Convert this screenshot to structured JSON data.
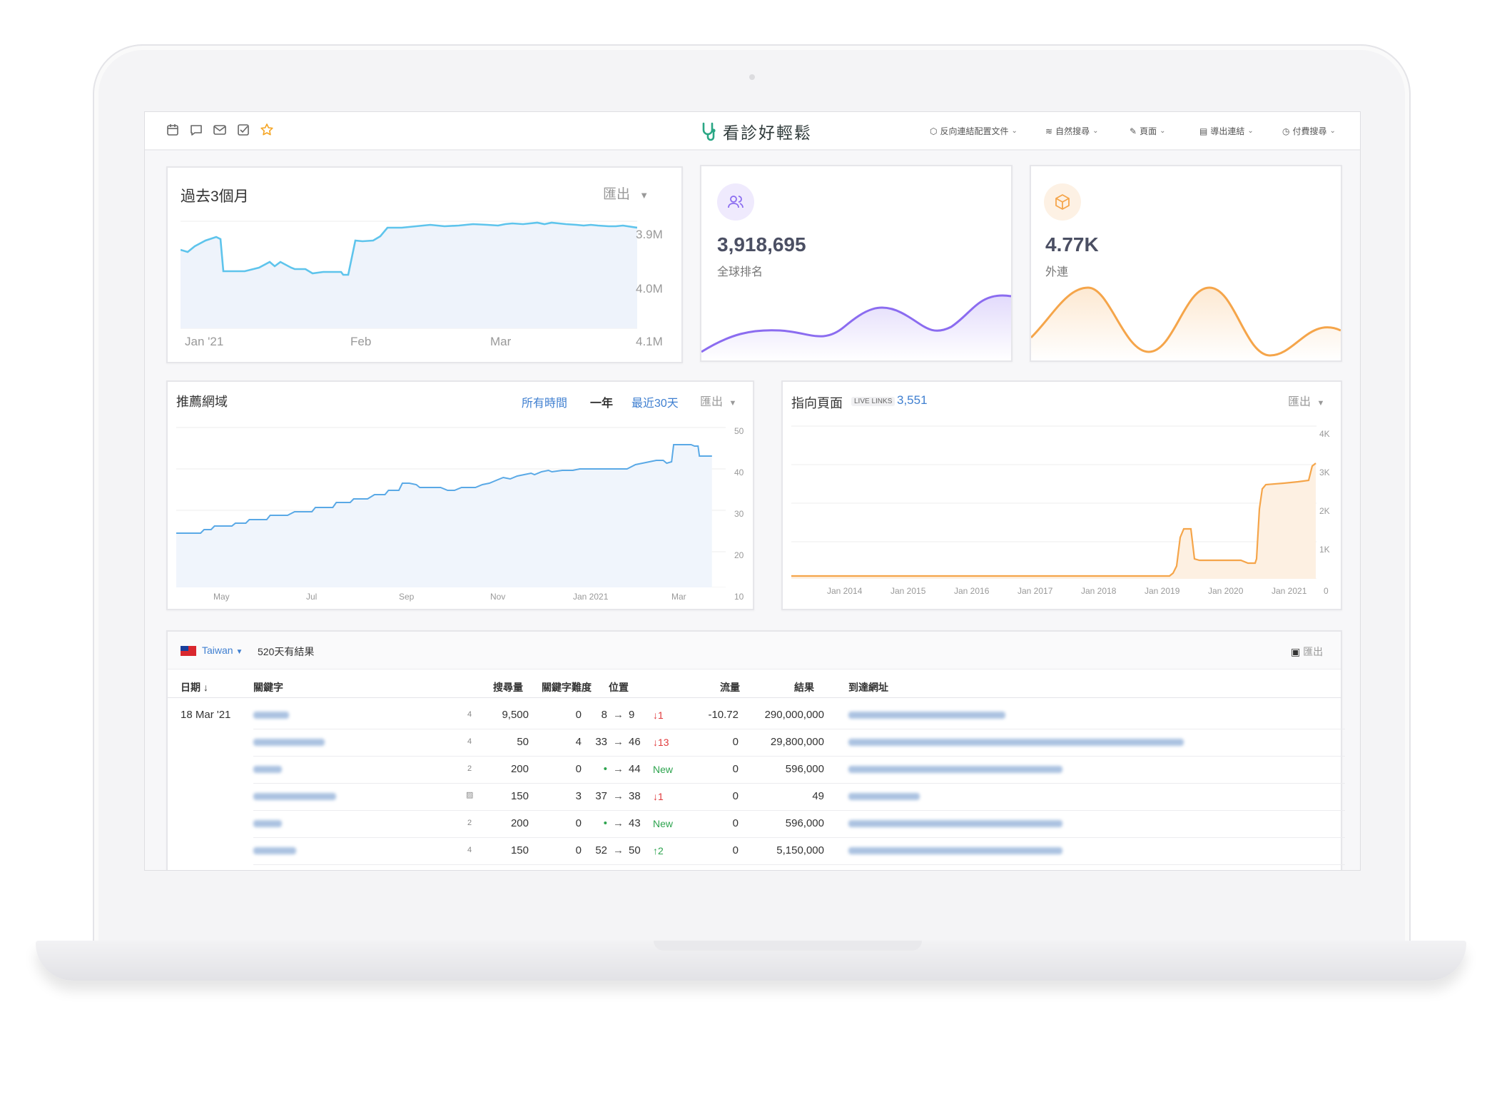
{
  "nav": {
    "logo_text": "看診好輕鬆",
    "menus": [
      {
        "label": "反向連結配置文件"
      },
      {
        "label": "自然搜尋"
      },
      {
        "label": "頁面"
      },
      {
        "label": "導出連結"
      },
      {
        "label": "付費搜尋"
      }
    ]
  },
  "rank_card": {
    "title": "過去3個月",
    "export_label": "匯出",
    "y_ticks": [
      "3.9M",
      "4.0M",
      "4.1M"
    ],
    "x_ticks": [
      "Jan '21",
      "Feb",
      "Mar"
    ]
  },
  "global_rank": {
    "value": "3,918,695",
    "label": "全球排名",
    "accent": "#8b6cf0"
  },
  "external_links": {
    "value": "4.77K",
    "label": "外連",
    "accent": "#f5a54a"
  },
  "referring_domains": {
    "title": "推薦網域",
    "ranges": [
      "所有時間",
      "一年",
      "最近30天"
    ],
    "export_label": "匯出",
    "y_ticks": [
      "50",
      "40",
      "30",
      "20",
      "10"
    ],
    "x_ticks": [
      "May",
      "Jul",
      "Sep",
      "Nov",
      "Jan 2021",
      "Mar"
    ]
  },
  "pages": {
    "title": "指向頁面",
    "live_label": "LIVE LINKS",
    "count": "3,551",
    "export_label": "匯出",
    "y_ticks": [
      "4K",
      "3K",
      "2K",
      "1K",
      "0"
    ],
    "x_ticks": [
      "Jan 2014",
      "Jan 2015",
      "Jan 2016",
      "Jan 2017",
      "Jan 2018",
      "Jan 2019",
      "Jan 2020",
      "Jan 2021"
    ]
  },
  "keywords": {
    "country": "Taiwan",
    "result_text": "520天有結果",
    "export_label": "匯出",
    "headers": {
      "date": "日期",
      "keyword": "關鍵字",
      "volume": "搜尋量",
      "difficulty": "關鍵字難度",
      "position": "位置",
      "traffic": "流量",
      "results": "結果",
      "url": "到達網址"
    },
    "date_value": "18 Mar '21",
    "rows": [
      {
        "badge": "4",
        "volume": "9,500",
        "kd": "0",
        "from": "8",
        "to": "9",
        "change": "↓1",
        "dir": "down",
        "traffic": "-10.72",
        "results": "290,000,000"
      },
      {
        "badge": "4",
        "volume": "50",
        "kd": "4",
        "from": "33",
        "to": "46",
        "change": "↓13",
        "dir": "down",
        "traffic": "0",
        "results": "29,800,000"
      },
      {
        "badge": "2",
        "volume": "200",
        "kd": "0",
        "from": "•",
        "to": "44",
        "change": "New",
        "dir": "new",
        "traffic": "0",
        "results": "596,000"
      },
      {
        "badge": "",
        "volume": "150",
        "kd": "3",
        "from": "37",
        "to": "38",
        "change": "↓1",
        "dir": "down",
        "traffic": "0",
        "results": "49"
      },
      {
        "badge": "2",
        "volume": "200",
        "kd": "0",
        "from": "•",
        "to": "43",
        "change": "New",
        "dir": "new",
        "traffic": "0",
        "results": "596,000"
      },
      {
        "badge": "4",
        "volume": "150",
        "kd": "0",
        "from": "52",
        "to": "50",
        "change": "↑2",
        "dir": "up",
        "traffic": "0",
        "results": "5,150,000"
      }
    ]
  },
  "colors": {
    "blue_line": "#5ec4ec",
    "blue_text": "#3f7fd0",
    "orange_line": "#f5a54a",
    "purple_line": "#8b6cf0",
    "red": "#e0393b",
    "green": "#2ea44f"
  }
}
